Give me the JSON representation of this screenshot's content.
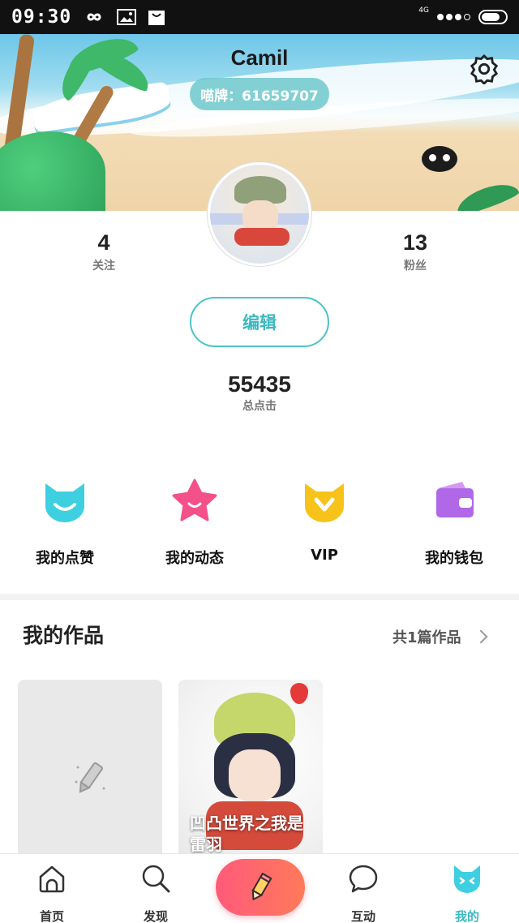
{
  "status_bar": {
    "time": "09:30",
    "network": "4G"
  },
  "profile": {
    "username": "Camil",
    "id_badge": "喵牌：61659707",
    "following_count": "4",
    "following_label": "关注",
    "followers_count": "13",
    "followers_label": "粉丝",
    "edit_label": "编辑",
    "total_clicks": "55435",
    "total_clicks_label": "总点击"
  },
  "quick_menu": [
    {
      "label": "我的点赞",
      "icon": "cat-smile-icon",
      "color": "#3ecfe0"
    },
    {
      "label": "我的动态",
      "icon": "star-smile-icon",
      "color": "#f4508a"
    },
    {
      "label": "VIP",
      "icon": "vip-cat-icon",
      "color": "#f7c21a"
    },
    {
      "label": "我的钱包",
      "icon": "wallet-icon",
      "color": "#b068e8"
    }
  ],
  "works": {
    "title": "我的作品",
    "count_label": "共1篇作品",
    "items": [
      {
        "title": "凹凸世界之我是雷羽"
      }
    ]
  },
  "bottom_nav": [
    {
      "label": "首页",
      "icon": "home-icon"
    },
    {
      "label": "发现",
      "icon": "search-icon"
    },
    {
      "label": "",
      "icon": "pencil-create-icon"
    },
    {
      "label": "互动",
      "icon": "chat-bubble-icon"
    },
    {
      "label": "我的",
      "icon": "cat-profile-icon",
      "active": true
    }
  ],
  "colors": {
    "accent": "#3bb8c0",
    "create_button": "#ff5a7a"
  }
}
